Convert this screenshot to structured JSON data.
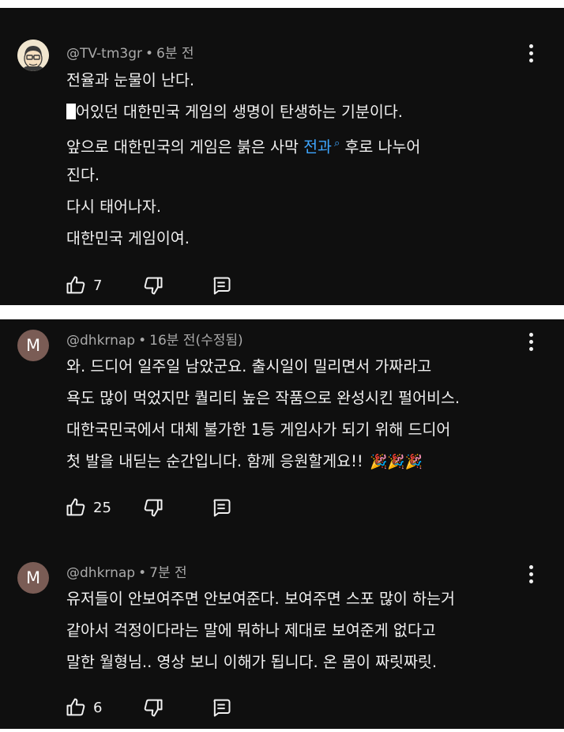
{
  "comments": [
    {
      "author": "@TV-tm3gr",
      "time": "6분 전",
      "lines": [
        "전율과 눈물이 난다.",
        "숙어있던 대한민국 게임의 생명이 탄생하는 기분이다.",
        "앞으로 대한민국의 게임은 붉은 사막 ",
        "진다.",
        "다시 태어나자.",
        "대한민국 게임이여."
      ],
      "line2_visible": "어있던 대한민국 게임의 생명이 탄생하는 기분이다.",
      "link_text": "전과",
      "line3_tail": " 후로 나누어",
      "likes": "7"
    },
    {
      "author": "@dhkrnap",
      "time": "16분 전(수정됨)",
      "avatar_letter": "M",
      "lines": [
        "와. 드디어 일주일 남았군요. 출시일이 밀리면서 가짜라고",
        "욕도 많이 먹었지만 퀄리티 높은 작품으로 완성시킨 펄어비스.",
        "대한국민국에서 대체 불가한 1등 게임사가 되기 위해 드디어",
        "첫 발을 내딛는 순간입니다. 함께 응원할게요!! "
      ],
      "emoji": "🎉🎉🎉",
      "likes": "25"
    },
    {
      "author": "@dhkrnap",
      "time": "7분 전",
      "avatar_letter": "M",
      "lines": [
        "유저들이 안보여주면 안보여준다. 보여주면 스포 많이 하는거",
        "같아서 걱정이다라는 말에 뭐하나 제대로 보여준게 없다고",
        "말한 월형님.. 영상 보니 이해가 됩니다. 온 몸이 짜릿짜릿."
      ],
      "likes": "6"
    }
  ],
  "separator": "•",
  "icons": {
    "like": "thumbs-up-icon",
    "dislike": "thumbs-down-icon",
    "reply": "reply-comment-icon",
    "menu": "more-vert-icon",
    "search": "search-icon"
  },
  "colors": {
    "background": "#0f0f0f",
    "text": "#f1f1f1",
    "meta": "#aaaaaa",
    "link": "#3ea6ff",
    "avatar_m": "#7a5c55"
  }
}
